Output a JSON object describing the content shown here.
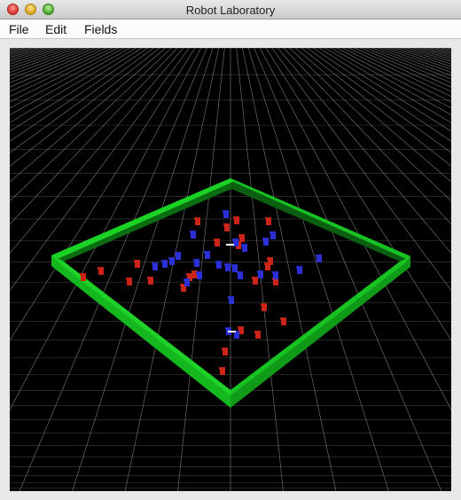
{
  "window": {
    "title": "Robot Laboratory"
  },
  "menu": {
    "items": [
      "File",
      "Edit",
      "Fields"
    ]
  },
  "scene": {
    "background_color": "#000000",
    "grid_color": "#8c8c8c",
    "wall_color": "#14b81e",
    "robot_colors": {
      "red": "#cc2418",
      "blue": "#2b2fd6"
    },
    "heading_marker_color": "#ffffff",
    "robot_counts": {
      "red": 25,
      "blue": 25
    }
  }
}
